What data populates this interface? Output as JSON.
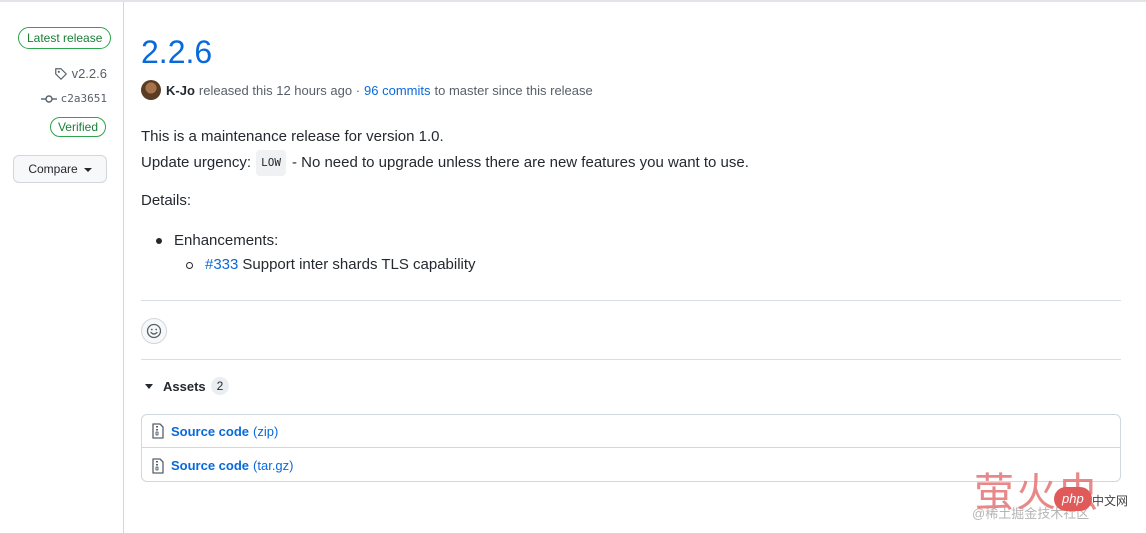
{
  "sidebar": {
    "latest_badge": "Latest release",
    "tag": "v2.2.6",
    "commit": "c2a3651",
    "verified": "Verified",
    "compare_label": "Compare"
  },
  "release": {
    "title": "2.2.6",
    "author": "K-Jo",
    "released_text": "released this 12 hours ago ·",
    "commits_link": "96 commits",
    "commits_suffix": "to master since this release",
    "paragraph1": "This is a maintenance release for version 1.0.",
    "urgency_label": "Update urgency:",
    "urgency_code": "LOW",
    "urgency_text": "- No need to upgrade unless there are new features you want to use.",
    "details_label": "Details:",
    "list_item": "Enhancements:",
    "subitem_link": "#333",
    "subitem_text": "Support inter shards TLS capability"
  },
  "assets": {
    "label": "Assets",
    "count": "2",
    "items": [
      {
        "name": "Source code",
        "ext": "(zip)"
      },
      {
        "name": "Source code",
        "ext": "(tar.gz)"
      }
    ]
  },
  "watermark": {
    "big": "萤火虫",
    "php": "php",
    "cn": "中文网",
    "small": "@稀土掘金技术社区"
  },
  "colors": {
    "link": "#0969da",
    "verified_green": "#1a7f37",
    "border": "#d0d7de"
  }
}
